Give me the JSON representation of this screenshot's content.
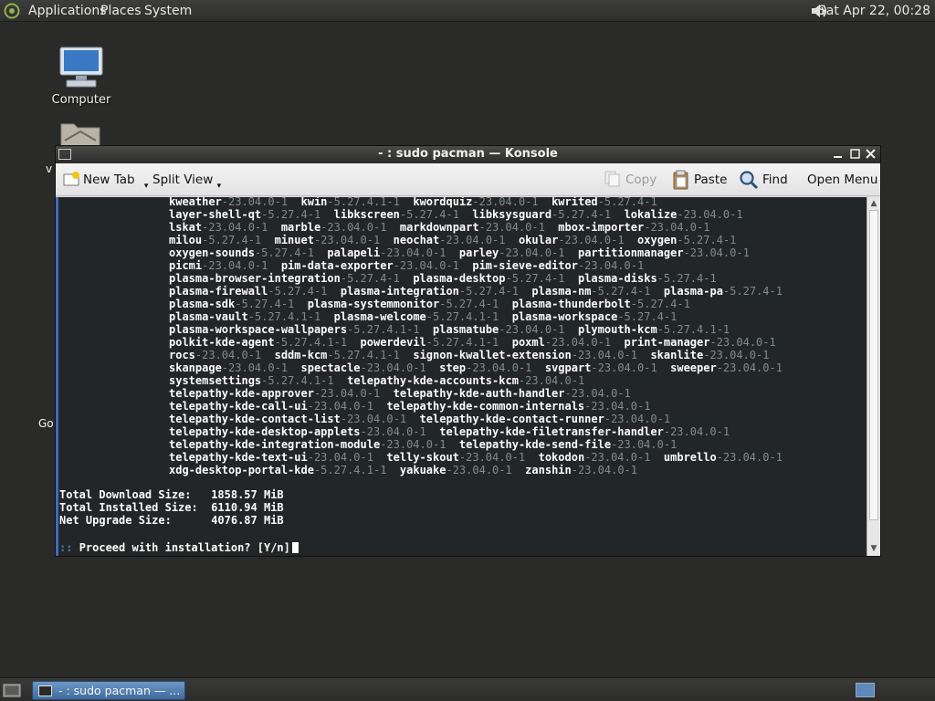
{
  "top_panel": {
    "menus": [
      "Applications",
      "Places",
      "System"
    ],
    "clock": "Sat Apr 22, 00:28"
  },
  "desktop": {
    "computer_label": "Computer",
    "partial_label_1": "v",
    "partial_label_2": "Go"
  },
  "window": {
    "title": "- : sudo pacman — Konsole",
    "toolbar": {
      "new_tab": "New Tab",
      "split_view": "Split View",
      "copy": "Copy",
      "paste": "Paste",
      "find": "Find",
      "open_menu": "Open Menu"
    },
    "terminal": {
      "package_lines": [
        [
          [
            "kweather",
            "-23.04.0-1"
          ],
          [
            "kwin",
            "-5.27.4.1-1"
          ],
          [
            "kwordquiz",
            "-23.04.0-1"
          ],
          [
            "kwrited",
            "-5.27.4-1"
          ]
        ],
        [
          [
            "layer-shell-qt",
            "-5.27.4-1"
          ],
          [
            "libkscreen",
            "-5.27.4-1"
          ],
          [
            "libksysguard",
            "-5.27.4-1"
          ],
          [
            "lokalize",
            "-23.04.0-1"
          ]
        ],
        [
          [
            "lskat",
            "-23.04.0-1"
          ],
          [
            "marble",
            "-23.04.0-1"
          ],
          [
            "markdownpart",
            "-23.04.0-1"
          ],
          [
            "mbox-importer",
            "-23.04.0-1"
          ]
        ],
        [
          [
            "milou",
            "-5.27.4-1"
          ],
          [
            "minuet",
            "-23.04.0-1"
          ],
          [
            "neochat",
            "-23.04.0-1"
          ],
          [
            "okular",
            "-23.04.0-1"
          ],
          [
            "oxygen",
            "-5.27.4-1"
          ]
        ],
        [
          [
            "oxygen-sounds",
            "-5.27.4-1"
          ],
          [
            "palapeli",
            "-23.04.0-1"
          ],
          [
            "parley",
            "-23.04.0-1"
          ],
          [
            "partitionmanager",
            "-23.04.0-1"
          ]
        ],
        [
          [
            "picmi",
            "-23.04.0-1"
          ],
          [
            "pim-data-exporter",
            "-23.04.0-1"
          ],
          [
            "pim-sieve-editor",
            "-23.04.0-1"
          ]
        ],
        [
          [
            "plasma-browser-integration",
            "-5.27.4-1"
          ],
          [
            "plasma-desktop",
            "-5.27.4-1"
          ],
          [
            "plasma-disks",
            "-5.27.4-1"
          ]
        ],
        [
          [
            "plasma-firewall",
            "-5.27.4-1"
          ],
          [
            "plasma-integration",
            "-5.27.4-1"
          ],
          [
            "plasma-nm",
            "-5.27.4-1"
          ],
          [
            "plasma-pa",
            "-5.27.4-1"
          ]
        ],
        [
          [
            "plasma-sdk",
            "-5.27.4-1"
          ],
          [
            "plasma-systemmonitor",
            "-5.27.4-1"
          ],
          [
            "plasma-thunderbolt",
            "-5.27.4-1"
          ]
        ],
        [
          [
            "plasma-vault",
            "-5.27.4.1-1"
          ],
          [
            "plasma-welcome",
            "-5.27.4.1-1"
          ],
          [
            "plasma-workspace",
            "-5.27.4-1"
          ]
        ],
        [
          [
            "plasma-workspace-wallpapers",
            "-5.27.4.1-1"
          ],
          [
            "plasmatube",
            "-23.04.0-1"
          ],
          [
            "plymouth-kcm",
            "-5.27.4.1-1"
          ]
        ],
        [
          [
            "polkit-kde-agent",
            "-5.27.4.1-1"
          ],
          [
            "powerdevil",
            "-5.27.4.1-1"
          ],
          [
            "poxml",
            "-23.04.0-1"
          ],
          [
            "print-manager",
            "-23.04.0-1"
          ]
        ],
        [
          [
            "rocs",
            "-23.04.0-1"
          ],
          [
            "sddm-kcm",
            "-5.27.4.1-1"
          ],
          [
            "signon-kwallet-extension",
            "-23.04.0-1"
          ],
          [
            "skanlite",
            "-23.04.0-1"
          ]
        ],
        [
          [
            "skanpage",
            "-23.04.0-1"
          ],
          [
            "spectacle",
            "-23.04.0-1"
          ],
          [
            "step",
            "-23.04.0-1"
          ],
          [
            "svgpart",
            "-23.04.0-1"
          ],
          [
            "sweeper",
            "-23.04.0-1"
          ]
        ],
        [
          [
            "systemsettings",
            "-5.27.4.1-1"
          ],
          [
            "telepathy-kde-accounts-kcm",
            "-23.04.0-1"
          ]
        ],
        [
          [
            "telepathy-kde-approver",
            "-23.04.0-1"
          ],
          [
            "telepathy-kde-auth-handler",
            "-23.04.0-1"
          ]
        ],
        [
          [
            "telepathy-kde-call-ui",
            "-23.04.0-1"
          ],
          [
            "telepathy-kde-common-internals",
            "-23.04.0-1"
          ]
        ],
        [
          [
            "telepathy-kde-contact-list",
            "-23.04.0-1"
          ],
          [
            "telepathy-kde-contact-runner",
            "-23.04.0-1"
          ]
        ],
        [
          [
            "telepathy-kde-desktop-applets",
            "-23.04.0-1"
          ],
          [
            "telepathy-kde-filetransfer-handler",
            "-23.04.0-1"
          ]
        ],
        [
          [
            "telepathy-kde-integration-module",
            "-23.04.0-1"
          ],
          [
            "telepathy-kde-send-file",
            "-23.04.0-1"
          ]
        ],
        [
          [
            "telepathy-kde-text-ui",
            "-23.04.0-1"
          ],
          [
            "telly-skout",
            "-23.04.0-1"
          ],
          [
            "tokodon",
            "-23.04.0-1"
          ],
          [
            "umbrello",
            "-23.04.0-1"
          ]
        ],
        [
          [
            "xdg-desktop-portal-kde",
            "-5.27.4.1-1"
          ],
          [
            "yakuake",
            "-23.04.0-1"
          ],
          [
            "zanshin",
            "-23.04.0-1"
          ]
        ]
      ],
      "summary": {
        "download_label": "Total Download Size:",
        "download_value": "1858.57 MiB",
        "installed_label": "Total Installed Size:",
        "installed_value": "6110.94 MiB",
        "upgrade_label": "Net Upgrade Size:",
        "upgrade_value": "4076.87 MiB"
      },
      "prompt_marker": "::",
      "prompt_text": "Proceed with installation? [Y/n]"
    }
  },
  "taskbar": {
    "task_label": "- : sudo pacman — ..."
  },
  "colors": {
    "terminal_bg": "#232627",
    "version_gray": "#7f8c8d",
    "prompt_blue": "#3b83d0",
    "task_blue": "#4f7db0"
  }
}
